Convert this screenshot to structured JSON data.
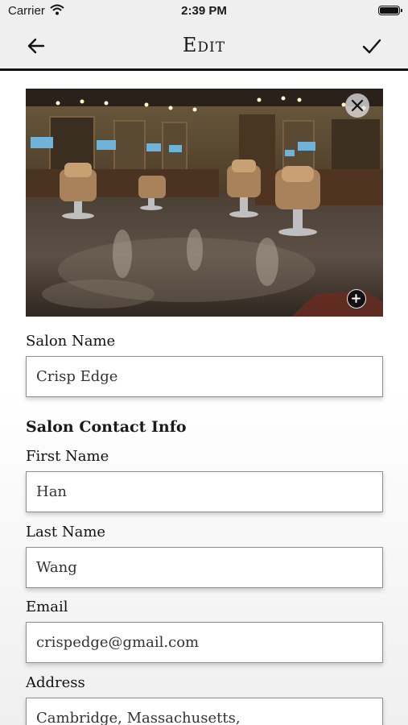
{
  "status_bar": {
    "carrier": "Carrier",
    "time": "2:39 PM"
  },
  "nav": {
    "title": "Edit",
    "back_icon": "back-arrow-icon",
    "done_icon": "checkmark-icon"
  },
  "photo": {
    "remove_icon": "close-icon",
    "add_icon": "plus-icon"
  },
  "form": {
    "salon_name_label": "Salon Name",
    "salon_name_value": "Crisp Edge",
    "contact_section_title": "Salon Contact Info",
    "first_name_label": "First Name",
    "first_name_value": "Han",
    "last_name_label": "Last Name",
    "last_name_value": "Wang",
    "email_label": "Email",
    "email_value": "crispedge@gmail.com",
    "address_label": "Address",
    "address_value": "Cambridge, Massachusetts,"
  },
  "colors": {
    "bar_background": "#efefef",
    "divider": "#111111",
    "field_border": "#8e8e8e"
  }
}
